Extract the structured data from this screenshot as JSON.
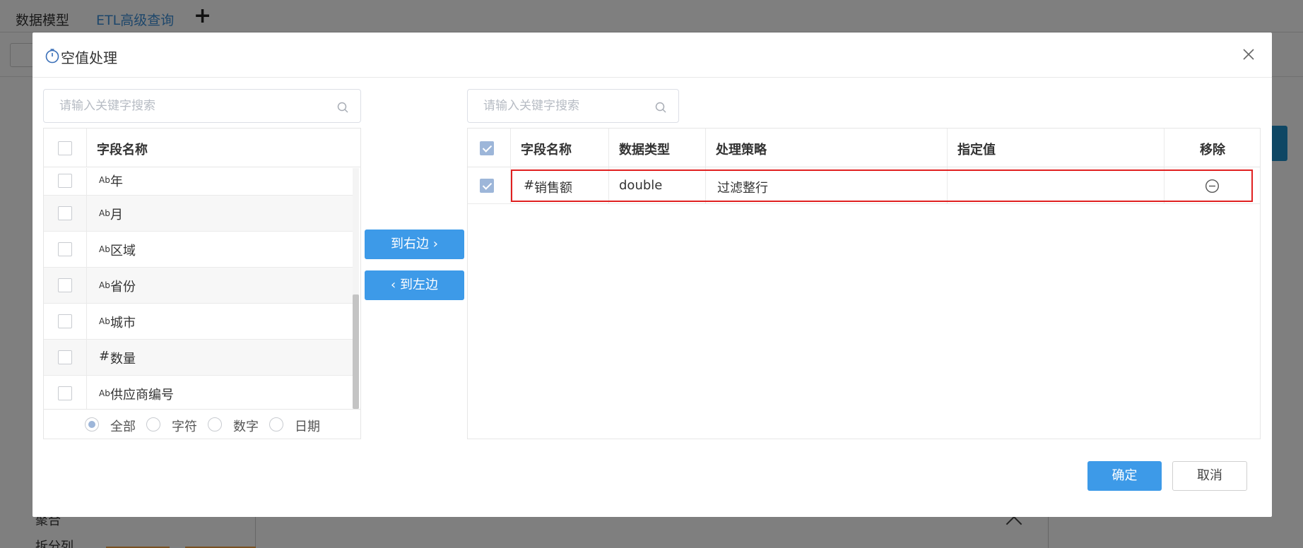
{
  "background": {
    "tabs": [
      "数据模型",
      "ETL高级查询"
    ],
    "add_tab_icon": "plus-icon",
    "sidebar_items": [
      "聚合",
      "拆分列"
    ]
  },
  "dialog": {
    "title": "空值处理",
    "title_icon": "timer-icon",
    "close_icon": "close-icon",
    "left": {
      "search_placeholder": "请输入关键字搜索",
      "header": "字段名称",
      "fields": [
        {
          "type_glyph": "Ab",
          "name": "年"
        },
        {
          "type_glyph": "Ab",
          "name": "月"
        },
        {
          "type_glyph": "Ab",
          "name": "区域"
        },
        {
          "type_glyph": "Ab",
          "name": "省份"
        },
        {
          "type_glyph": "Ab",
          "name": "城市"
        },
        {
          "type_glyph": "#",
          "name": "数量"
        },
        {
          "type_glyph": "Ab",
          "name": "供应商编号"
        }
      ],
      "filters": [
        {
          "label": "全部",
          "selected": true
        },
        {
          "label": "字符",
          "selected": false
        },
        {
          "label": "数字",
          "selected": false
        },
        {
          "label": "日期",
          "selected": false
        }
      ]
    },
    "to_right_label": "到右边 ›",
    "to_left_label": "‹ 到左边",
    "right": {
      "search_placeholder": "请输入关键字搜索",
      "headers": {
        "field_name": "字段名称",
        "data_type": "数据类型",
        "strategy": "处理策略",
        "value": "指定值",
        "remove": "移除"
      },
      "rows": [
        {
          "checked": true,
          "type_glyph": "#",
          "field_name": "销售额",
          "data_type": "double",
          "strategy": "过滤整行",
          "value": ""
        }
      ]
    },
    "ok_label": "确定",
    "cancel_label": "取消"
  },
  "colors": {
    "primary": "#3d9ae8",
    "checkbox_checked": "#9db6d9",
    "highlight_border": "#e02020"
  }
}
